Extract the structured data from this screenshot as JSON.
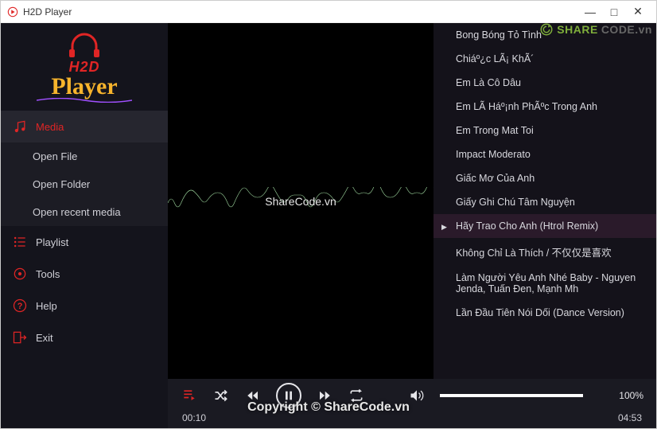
{
  "window": {
    "title": "H2D Player"
  },
  "logo": {
    "line1": "H2D",
    "line2": "Player"
  },
  "sidebar": {
    "media": {
      "label": "Media"
    },
    "media_sub": [
      {
        "label": "Open File"
      },
      {
        "label": "Open Folder"
      },
      {
        "label": "Open recent media"
      }
    ],
    "playlist": {
      "label": "Playlist"
    },
    "tools": {
      "label": "Tools"
    },
    "help": {
      "label": "Help"
    },
    "exit": {
      "label": "Exit"
    }
  },
  "viz": {
    "overlay_text": "ShareCode.vn"
  },
  "playlist_items": [
    {
      "title": "Bong Bóng Tỏ Tình",
      "playing": false
    },
    {
      "title": "Chiáº¿c LÃ¡ KhÃ´",
      "playing": false
    },
    {
      "title": "Em Là Cô Dâu",
      "playing": false
    },
    {
      "title": "Em LÃ  Háº¡nh PhÃºc Trong Anh",
      "playing": false
    },
    {
      "title": "Em Trong Mat Toi",
      "playing": false
    },
    {
      "title": "Impact Moderato",
      "playing": false
    },
    {
      "title": "Giấc Mơ Của Anh",
      "playing": false
    },
    {
      "title": "Giấy Ghi Chú Tâm Nguyện",
      "playing": false
    },
    {
      "title": "Hãy Trao Cho Anh (Htrol Remix)",
      "playing": true
    },
    {
      "title": "Không Chỉ Là Thích / 不仅仅是喜欢",
      "playing": false
    },
    {
      "title": "Làm Người Yêu Anh Nhé Baby - Nguyen Jenda, Tuấn Đen, Mạnh Mh",
      "playing": false
    },
    {
      "title": "Lần Đầu Tiên Nói Dối (Dance Version)",
      "playing": false
    }
  ],
  "controls": {
    "volume_pct": "100%",
    "elapsed": "00:10",
    "duration": "04:53"
  },
  "watermark": {
    "a": "SHARE",
    "b": "CODE.vn"
  },
  "copyright": "Copyright © ShareCode.vn"
}
